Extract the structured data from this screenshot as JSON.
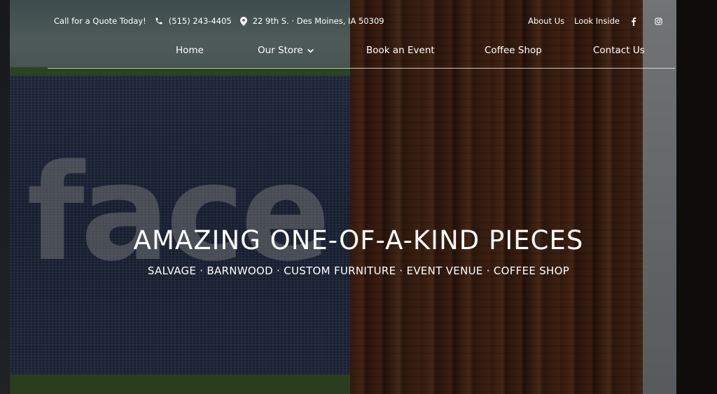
{
  "topbar": {
    "quote_cta": "Call for a Quote Today!",
    "phone": "(515) 243-4405",
    "address": "22 9th S. · Des Moines, IA 50309",
    "links": [
      "About Us",
      "Look Inside"
    ],
    "icons": {
      "phone": "phone-icon",
      "location": "map-pin-icon",
      "facebook": "facebook-icon",
      "instagram": "instagram-icon"
    }
  },
  "nav": {
    "items": [
      "Home",
      "Our Store",
      "Book an Event",
      "Coffee Shop",
      "Contact Us"
    ],
    "dropdown_icon": "chevron-down-icon"
  },
  "hero": {
    "background_text": "face",
    "headline": "AMAZING ONE-OF-A-KIND PIECES",
    "subline": "SALVAGE · BARNWOOD · CUSTOM FURNITURE · EVENT VENUE · COFFEE SHOP"
  },
  "colors": {
    "text": "#ffffff",
    "overlay": "rgba(0,0,0,0.45)"
  }
}
